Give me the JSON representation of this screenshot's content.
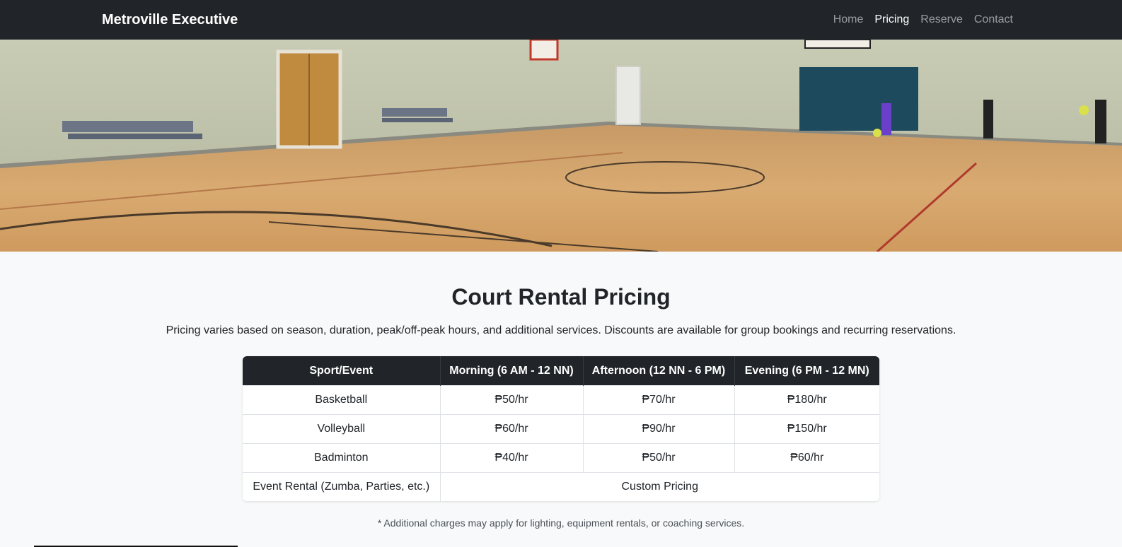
{
  "navbar": {
    "brand": "Metroville Executive",
    "links": [
      "Home",
      "Pricing",
      "Reserve",
      "Contact"
    ],
    "active": "Pricing"
  },
  "hero": {
    "image": "basketball-court-photo"
  },
  "main": {
    "title": "Court Rental Pricing",
    "subtitle": "Pricing varies based on season, duration, peak/off-peak hours, and additional services. Discounts are available for group bookings and recurring reservations.",
    "table": {
      "headers": [
        "Sport/Event",
        "Morning (6 AM - 12 NN)",
        "Afternoon (12 NN - 6 PM)",
        "Evening (6 PM - 12 MN)"
      ],
      "rows": [
        [
          "Basketball",
          "₱50/hr",
          "₱70/hr",
          "₱180/hr"
        ],
        [
          "Volleyball",
          "₱60/hr",
          "₱90/hr",
          "₱150/hr"
        ],
        [
          "Badminton",
          "₱40/hr",
          "₱50/hr",
          "₱60/hr"
        ]
      ],
      "event_row": {
        "name": "Event Rental (Zumba, Parties, etc.)",
        "price": "Custom Pricing"
      }
    },
    "note": "* Additional charges may apply for lighting, equipment rentals, or coaching services."
  },
  "colors": {
    "navbar": "#212529",
    "page_bg": "#f8f9fa",
    "table_header": "#212529"
  }
}
